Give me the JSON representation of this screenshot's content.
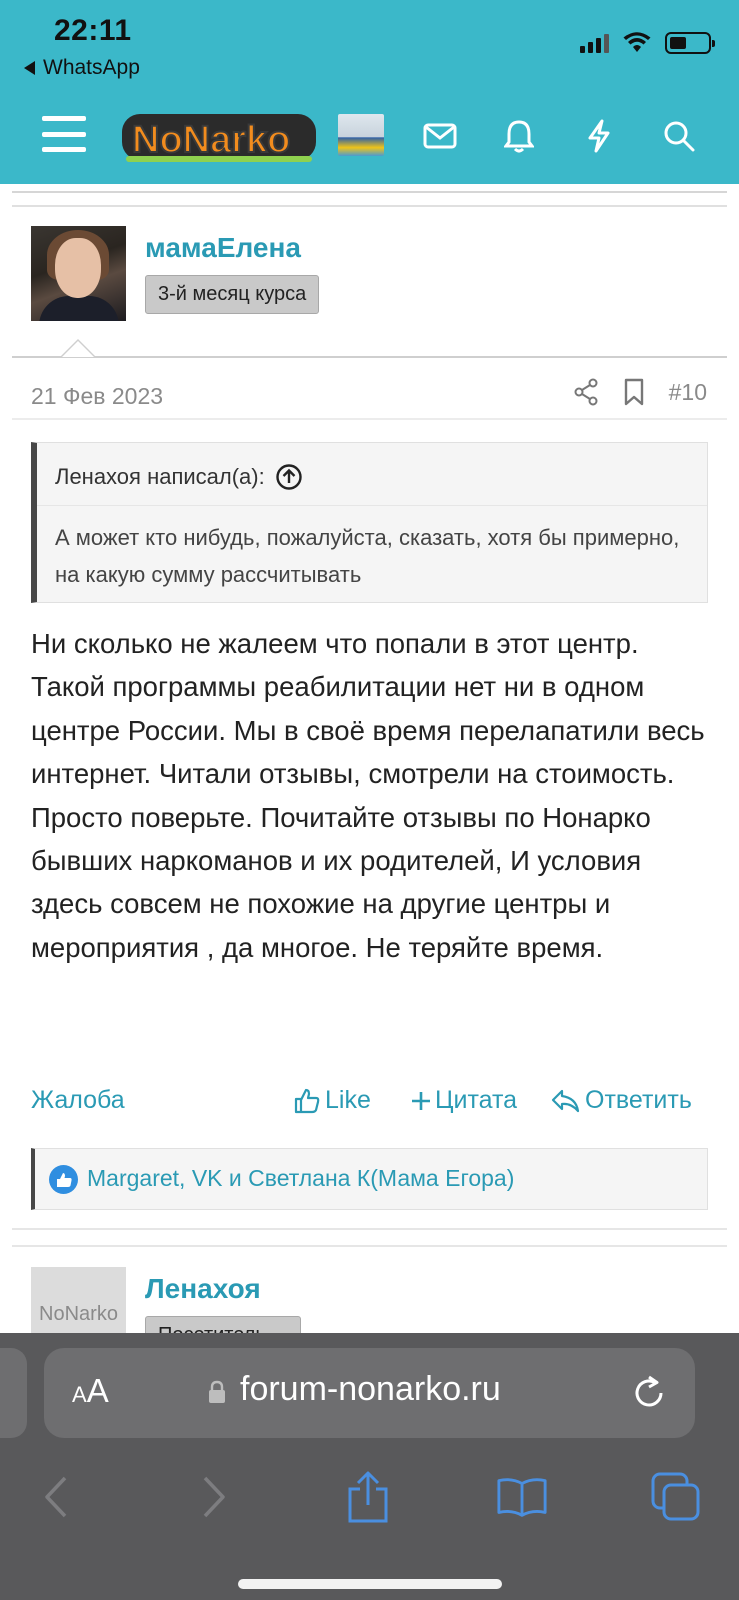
{
  "status_bar": {
    "time": "22:11",
    "back_app": "WhatsApp"
  },
  "nav": {
    "logo_text": "NoNarko",
    "icons": [
      "menu-icon",
      "mail-icon",
      "bell-icon",
      "lightning-icon",
      "search-icon"
    ]
  },
  "post": {
    "username": "мамаЕлена",
    "user_title": "3-й месяц курса",
    "date": "21 Фев 2023",
    "number": "#10",
    "quote": {
      "author_line": "Ленахоя написал(а):",
      "text": "А может кто нибудь, пожалуйста, сказать, хотя бы примерно, на какую сумму рассчитывать"
    },
    "text": "Ни сколько не жалеем что попали в этот центр. Такой программы реабилитации нет ни в одном центре России. Мы в своё время перелапатили весь интернет. Читали отзывы, смотрели на стоимость. Просто поверьте. Почитайте отзывы по Нонарко бывших наркоманов и их родителей, И условия здесь совсем не похожие на другие центры и мероприятия , да многое. Не теряйте время.",
    "actions": {
      "report": "Жалоба",
      "like": "Like",
      "quote": "Цитата",
      "reply": "Ответить"
    },
    "likes": "Margaret, VK и Светлана К(Мама Егора)"
  },
  "next_post": {
    "avatar_text": "NoNarko",
    "username": "Ленахоя",
    "user_title": "Посетитель"
  },
  "browser": {
    "aa_label": "AA",
    "url": "forum-nonarko.ru"
  },
  "colors": {
    "header_bg": "#3bb8c9",
    "link": "#2a9ab4",
    "browser_bg": "#59595b"
  }
}
